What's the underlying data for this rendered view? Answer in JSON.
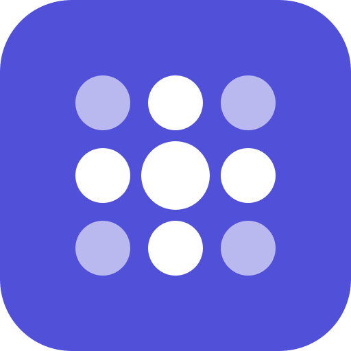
{
  "icon": {
    "name": "dot-grid-app-icon",
    "shape": "rounded-square",
    "grid": {
      "rows": 3,
      "columns": 3
    },
    "colors": {
      "background": "#5050D8",
      "dot_solid": "#FFFFFF",
      "dot_faded": "#B9B9F0"
    },
    "dots": [
      {
        "row": 1,
        "col": 1,
        "style": "faded"
      },
      {
        "row": 1,
        "col": 2,
        "style": "solid"
      },
      {
        "row": 1,
        "col": 3,
        "style": "faded"
      },
      {
        "row": 2,
        "col": 1,
        "style": "solid"
      },
      {
        "row": 2,
        "col": 2,
        "style": "solid",
        "emphasis": "large"
      },
      {
        "row": 2,
        "col": 3,
        "style": "solid"
      },
      {
        "row": 3,
        "col": 1,
        "style": "faded"
      },
      {
        "row": 3,
        "col": 2,
        "style": "solid"
      },
      {
        "row": 3,
        "col": 3,
        "style": "faded"
      }
    ]
  }
}
